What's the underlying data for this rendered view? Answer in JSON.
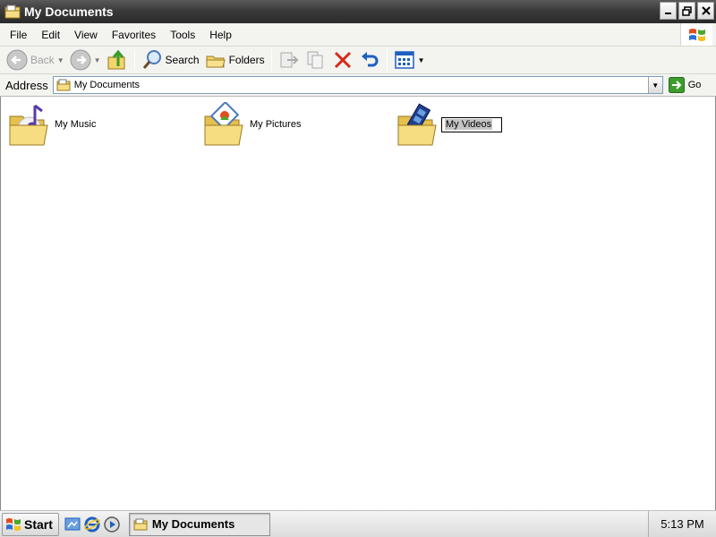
{
  "window": {
    "title": "My Documents"
  },
  "menu": [
    "File",
    "Edit",
    "View",
    "Favorites",
    "Tools",
    "Help"
  ],
  "toolbar": {
    "back_label": "Back",
    "search_label": "Search",
    "folders_label": "Folders"
  },
  "address": {
    "label": "Address",
    "value": "My Documents",
    "go_label": "Go"
  },
  "items": [
    {
      "name": "My Music",
      "icon": "music-folder-icon"
    },
    {
      "name": "My Pictures",
      "icon": "pictures-folder-icon"
    },
    {
      "name": "My Videos",
      "icon": "videos-folder-icon",
      "state": "renaming"
    }
  ],
  "taskbar": {
    "start_label": "Start",
    "task_label": "My Documents",
    "clock": "5:13 PM"
  },
  "colors": {
    "folder": "#f3d56b",
    "accent_blue": "#1f5fbf",
    "delete_red": "#d62a1a",
    "go_green": "#3c9c2c"
  }
}
